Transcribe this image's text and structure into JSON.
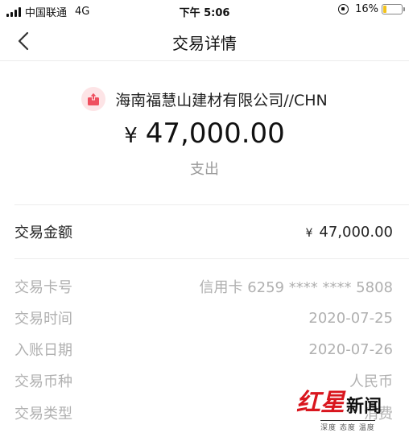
{
  "status_bar": {
    "carrier": "中国联通",
    "network": "4G",
    "time": "下午 5:06",
    "battery_percent": "16%",
    "battery_level": 0.16
  },
  "nav": {
    "title": "交易详情"
  },
  "merchant": {
    "name": "海南福慧山建材有限公司//CHN"
  },
  "summary": {
    "currency_symbol": "¥",
    "amount": "47,000.00",
    "type": "支出"
  },
  "details": {
    "amount_label": "交易金额",
    "amount_currency": "¥",
    "amount_value": "47,000.00",
    "rows": [
      {
        "label": "交易卡号",
        "value": "信用卡 6259 **** **** 5808"
      },
      {
        "label": "交易时间",
        "value": "2020-07-25"
      },
      {
        "label": "入账日期",
        "value": "2020-07-26"
      },
      {
        "label": "交易币种",
        "value": "人民币"
      },
      {
        "label": "交易类型",
        "value": "消费"
      }
    ]
  },
  "watermark": {
    "brand_red": "红星",
    "brand_black": "新闻",
    "slogan": "深度 态度 温度"
  },
  "colors": {
    "accent_red": "#d9161e",
    "battery": "#f2c21b",
    "muted_text": "#b0b0b0"
  }
}
